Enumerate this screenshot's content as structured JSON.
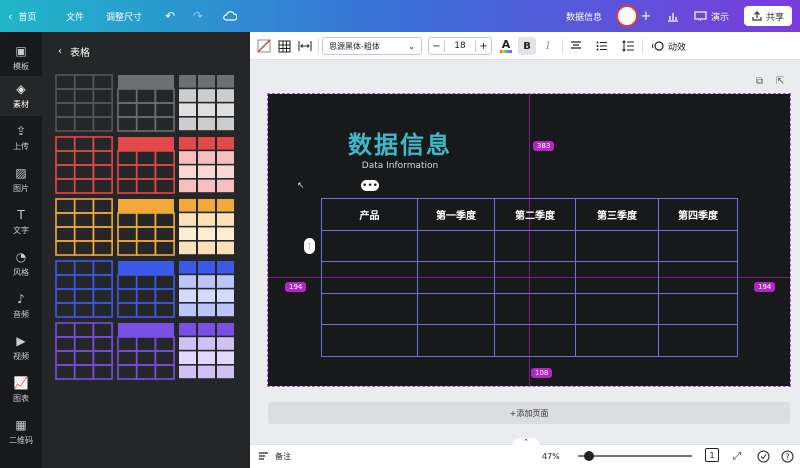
{
  "topbar": {
    "home": "首页",
    "file": "文件",
    "resize": "调整尺寸",
    "doc_title": "数据信息",
    "present": "演示",
    "share": "共享"
  },
  "rail": [
    {
      "label": "模板",
      "icon": "template-icon"
    },
    {
      "label": "素材",
      "icon": "elements-icon"
    },
    {
      "label": "上传",
      "icon": "upload-icon"
    },
    {
      "label": "图片",
      "icon": "photo-icon"
    },
    {
      "label": "文字",
      "icon": "text-icon"
    },
    {
      "label": "风格",
      "icon": "palette-icon"
    },
    {
      "label": "音频",
      "icon": "music-icon"
    },
    {
      "label": "视频",
      "icon": "video-icon"
    },
    {
      "label": "图表",
      "icon": "chart-icon"
    },
    {
      "label": "二维码",
      "icon": "qrcode-icon"
    }
  ],
  "panel": {
    "title": "表格",
    "table_colors": [
      "#4a4b4e",
      "#e34949",
      "#f2a93b",
      "#3d59e8",
      "#7a4fe3"
    ]
  },
  "toolbar": {
    "font": "思源黑体-粗体",
    "minus": "−",
    "size": "18",
    "plus": "+",
    "text_color_glyph": "A",
    "bold": "B",
    "italic": "I",
    "animate": "动效"
  },
  "canvas": {
    "title": "数据信息",
    "subtitle": "Data Information",
    "headers": [
      "产品",
      "第一季度",
      "第二季度",
      "第三季度",
      "第四季度"
    ],
    "rows": [
      [
        "",
        "",
        "",
        "",
        ""
      ],
      [
        "",
        "",
        "",
        "",
        ""
      ],
      [
        "",
        "",
        "",
        "",
        ""
      ],
      [
        "",
        "",
        "",
        "",
        ""
      ]
    ],
    "guide_top": "383",
    "guide_left": "194",
    "guide_right": "194",
    "guide_bottom": "108"
  },
  "add_page": "+添加页面",
  "bottombar": {
    "notes": "备注",
    "zoom": "47%",
    "page_num": "1"
  },
  "colors": {
    "title": "#3fb8c9",
    "guide": "#b326c6",
    "table_border": "#6d74d8"
  }
}
